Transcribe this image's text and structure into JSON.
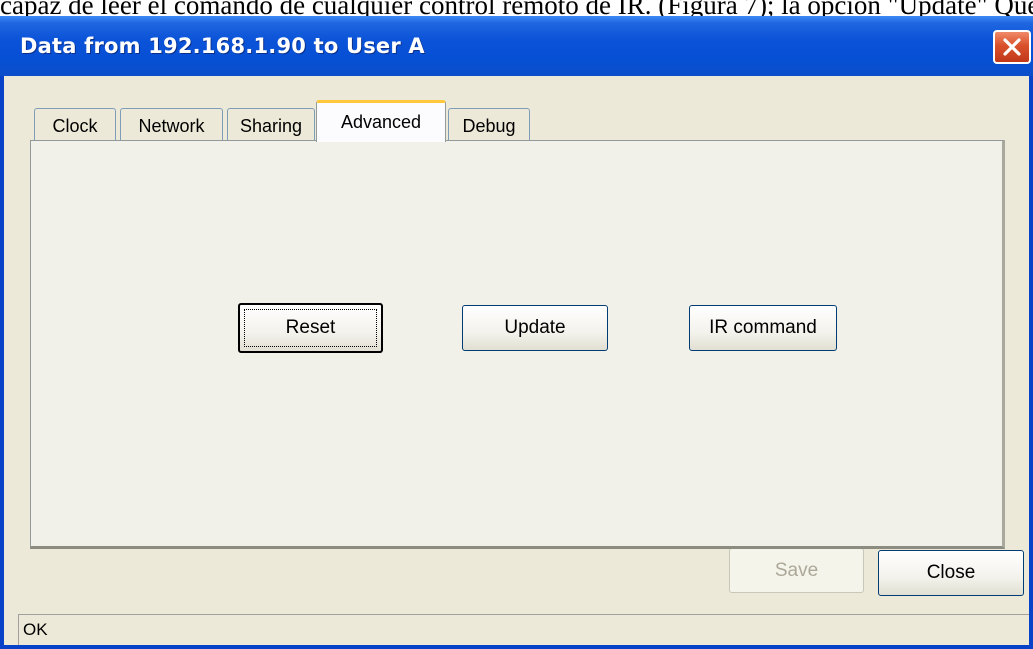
{
  "background_text": "capaz de leer el comando de cualquier control remoto de IR. (Figura 7); la opción \"Update\" Que ha actualiza",
  "window": {
    "title": "Data from 192.168.1.90 to User A",
    "close_icon": "close-icon"
  },
  "tabs": [
    {
      "label": "Clock",
      "active": false
    },
    {
      "label": "Network",
      "active": false
    },
    {
      "label": "Sharing",
      "active": false
    },
    {
      "label": "Advanced",
      "active": true
    },
    {
      "label": "Debug",
      "active": false
    }
  ],
  "advanced_panel": {
    "reset_label": "Reset",
    "update_label": "Update",
    "ir_command_label": "IR command"
  },
  "footer": {
    "save_label": "Save",
    "save_enabled": false,
    "close_label": "Close"
  },
  "status": {
    "text": "OK"
  },
  "colors": {
    "titlebar": "#0b53d8",
    "face": "#ece9d8",
    "close_button": "#d9522b",
    "active_tab_highlight": "#ffc83c"
  }
}
